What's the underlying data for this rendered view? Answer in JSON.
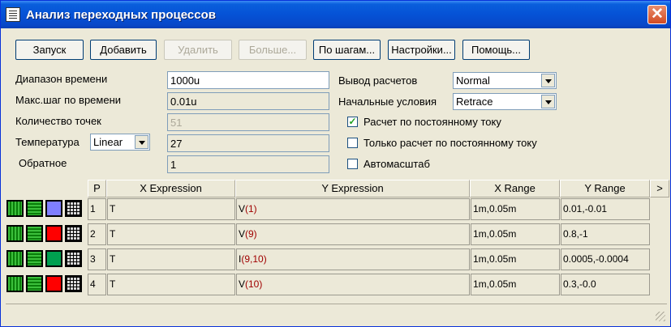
{
  "window": {
    "title": "Анализ переходных процессов",
    "close_glyph": "✕"
  },
  "toolbar": {
    "run": "Запуск",
    "add": "Добавить",
    "delete": "Удалить",
    "more": "Больше...",
    "stepping": "По шагам...",
    "settings": "Настройки...",
    "help": "Помощь..."
  },
  "params": {
    "time_range_label": "Диапазон времени",
    "time_range_value": "1000u",
    "max_step_label": "Макс.шаг по времени",
    "max_step_value": "0.01u",
    "points_label": "Количество точек",
    "points_value": "51",
    "temperature_label": "Температура",
    "temperature_mode": "Linear",
    "temperature_value": "27",
    "reverse_label": "Обратное",
    "reverse_value": "1",
    "output_label": "Вывод расчетов",
    "output_value": "Normal",
    "initial_label": "Начальные условия",
    "initial_value": "Retrace",
    "dc_label": "Расчет по постоянному току",
    "dc_checked": true,
    "dc_only_label": "Только расчет по постоянному току",
    "dc_only_checked": false,
    "autoscale_label": "Автомасштаб",
    "autoscale_checked": false,
    "checkmark": "✓"
  },
  "table": {
    "headers": {
      "p": "P",
      "x": "X Expression",
      "y": "Y Expression",
      "xr": "X Range",
      "yr": "Y Range",
      "more": ">"
    },
    "rows": [
      {
        "p": "1",
        "x": "T",
        "y_fn": "V",
        "y_arg": "(1)",
        "xr": "1m,0.05m",
        "yr": "0.01,-0.01",
        "color": "#7f7fff"
      },
      {
        "p": "2",
        "x": "T",
        "y_fn": "V",
        "y_arg": "(9)",
        "xr": "1m,0.05m",
        "yr": "0.8,-1",
        "color": "#ff0000"
      },
      {
        "p": "3",
        "x": "T",
        "y_fn": "I",
        "y_arg": "(9,10)",
        "xr": "1m,0.05m",
        "yr": "0.0005,-0.0004",
        "color": "#00a050"
      },
      {
        "p": "4",
        "x": "T",
        "y_fn": "V",
        "y_arg": "(10)",
        "xr": "1m,0.05m",
        "yr": "0.3,-0.0",
        "color": "#ff0000"
      }
    ]
  }
}
